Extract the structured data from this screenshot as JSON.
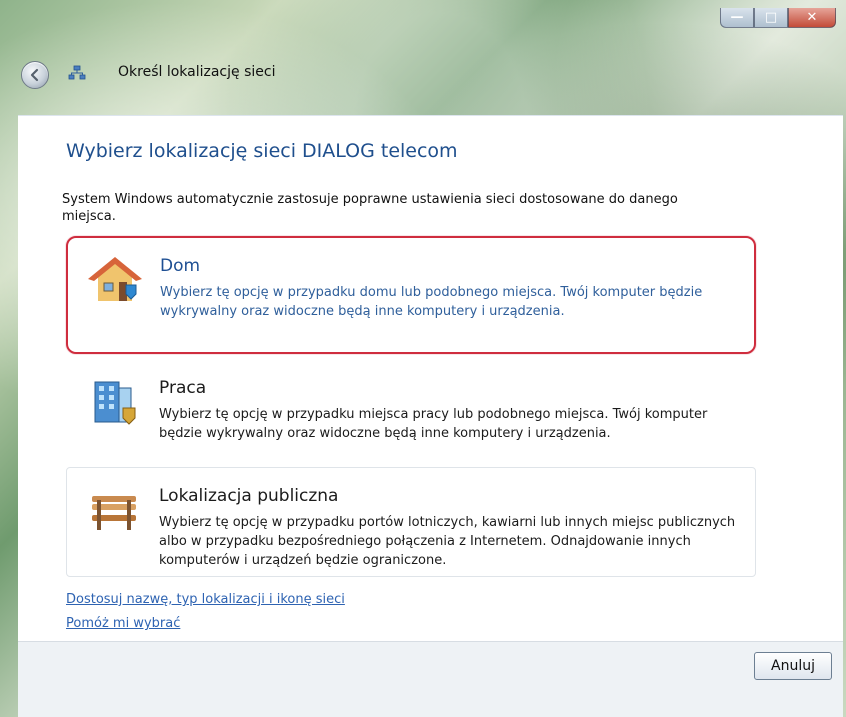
{
  "window": {
    "title": "Określ lokalizację sieci"
  },
  "main": {
    "heading": "Wybierz lokalizację sieci DIALOG telecom",
    "intro": "System Windows automatycznie zastosuje poprawne ustawienia sieci dostosowane do danego miejsca."
  },
  "options": [
    {
      "title": "Dom",
      "description": "Wybierz tę opcję w przypadku domu lub podobnego miejsca. Twój komputer będzie wykrywalny oraz widoczne będą inne komputery i urządzenia."
    },
    {
      "title": "Praca",
      "description": "Wybierz tę opcję w przypadku miejsca pracy lub podobnego miejsca. Twój komputer będzie wykrywalny oraz widoczne będą inne komputery i urządzenia."
    },
    {
      "title": "Lokalizacja publiczna",
      "description": "Wybierz tę opcję w przypadku portów lotniczych, kawiarni lub innych miejsc publicznych albo w przypadku bezpośredniego połączenia z Internetem. Odnajdowanie innych komputerów i urządzeń będzie ograniczone."
    }
  ],
  "links": [
    "Dostosuj nazwę, typ lokalizacji i ikonę sieci",
    "Pomóż mi wybrać"
  ],
  "footer": {
    "cancel_label": "Anuluj"
  },
  "colors": {
    "selected_border": "#cf2d3e",
    "heading": "#1f4f8d",
    "link": "#2e63b2"
  },
  "icons": {
    "back": "back-arrow-icon",
    "network": "network-icon",
    "home": "house-icon",
    "work": "office-building-icon",
    "public": "bench-icon"
  }
}
